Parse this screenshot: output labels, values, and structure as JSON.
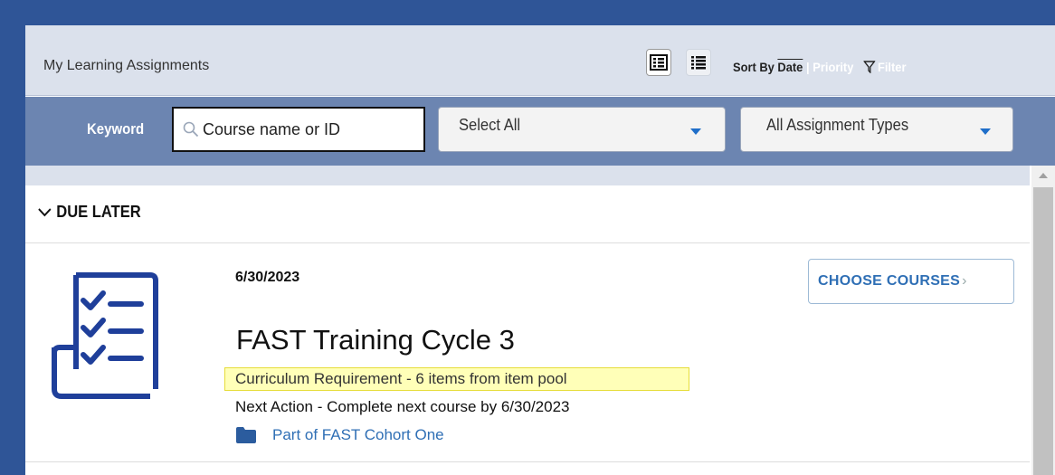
{
  "header": {
    "title": "My Learning Assignments",
    "sort_label": "Sort By",
    "sort_date": "Date",
    "sort_separator": "|",
    "sort_priority": "Priority",
    "filter_label": "Filter"
  },
  "toolbar": {
    "keyword_label": "Keyword",
    "keyword_placeholder": "Course name or ID",
    "select_status": "Select All",
    "select_type": "All Assignment Types"
  },
  "section": {
    "title": "DUE LATER"
  },
  "assignment": {
    "due_date": "6/30/2023",
    "title": "FAST Training Cycle 3",
    "requirement": "Curriculum Requirement - 6 items from item pool",
    "next_action": "Next Action - Complete next course by 6/30/2023",
    "cohort_link": "Part of FAST Cohort One",
    "choose_button": "CHOOSE COURSES",
    "choose_chevron": "›"
  },
  "colors": {
    "frame": "#2f5597",
    "header_bg": "#dbe1ec",
    "toolbar_bg": "#6c85b1",
    "link": "#2f6fb5",
    "icon_blue": "#1f3f9a",
    "highlight": "#ffffb8"
  },
  "icons": {
    "detail_view": "list-detail-icon",
    "compact_view": "list-compact-icon",
    "filter": "funnel-icon",
    "search": "search-icon",
    "section_toggle": "chevron-down-icon",
    "assignment": "checklist-icon",
    "cohort": "folder-icon"
  }
}
